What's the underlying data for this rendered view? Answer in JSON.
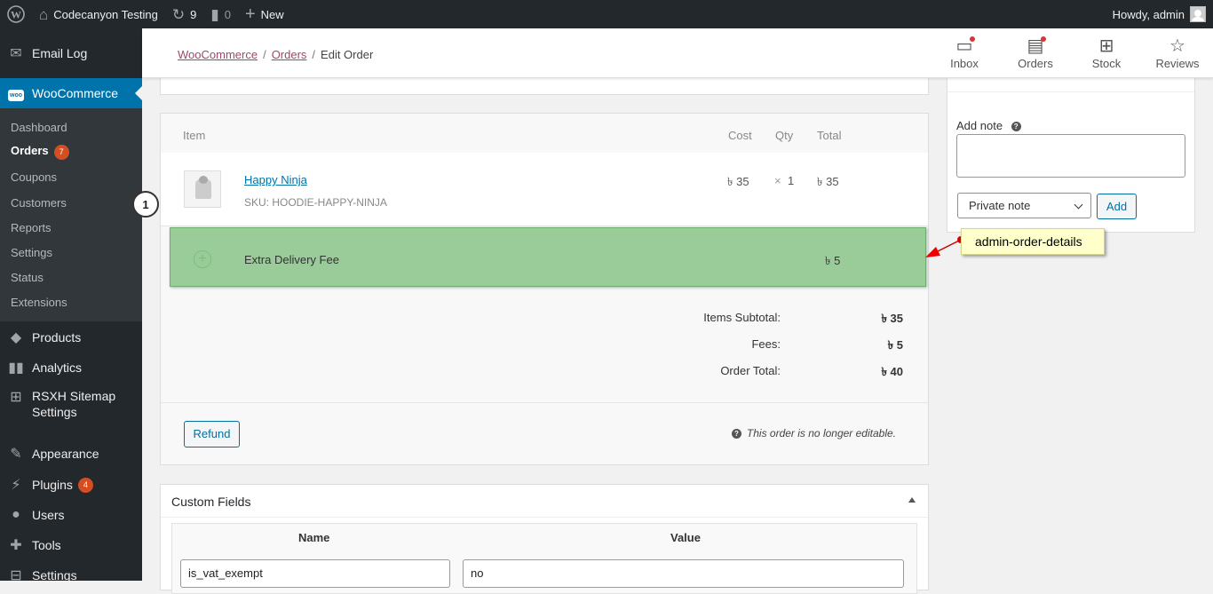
{
  "adminbar": {
    "site_name": "Codecanyon Testing",
    "updates_count": "9",
    "comments_count": "0",
    "new_label": "New",
    "howdy": "Howdy, admin"
  },
  "sidebar": {
    "email_log": "Email Log",
    "woocommerce": "WooCommerce",
    "submenu": {
      "dashboard": "Dashboard",
      "orders": "Orders",
      "orders_count": "7",
      "coupons": "Coupons",
      "customers": "Customers",
      "reports": "Reports",
      "settings": "Settings",
      "status": "Status",
      "extensions": "Extensions"
    },
    "products": "Products",
    "analytics": "Analytics",
    "rsxh_line1": "RSXH Sitemap",
    "rsxh_line2": "Settings",
    "appearance": "Appearance",
    "plugins": "Plugins",
    "plugins_count": "4",
    "users": "Users",
    "tools": "Tools",
    "settings": "Settings",
    "step_marker": "1"
  },
  "header": {
    "breadcrumb": [
      "WooCommerce",
      "Orders",
      "Edit Order"
    ],
    "actions": {
      "inbox": "Inbox",
      "orders": "Orders",
      "stock": "Stock",
      "reviews": "Reviews"
    }
  },
  "items": {
    "columns": {
      "item": "Item",
      "cost": "Cost",
      "qty": "Qty",
      "total": "Total"
    },
    "line": {
      "name": "Happy Ninja",
      "sku": "SKU: HOODIE-HAPPY-NINJA",
      "cost": "৳ 35",
      "qty_x": "×",
      "qty": "1",
      "total": "৳ 35"
    },
    "fee": {
      "name": "Extra Delivery Fee",
      "total": "৳ 5"
    },
    "totals": {
      "subtotal_label": "Items Subtotal:",
      "subtotal_value": "৳ 35",
      "fees_label": "Fees:",
      "fees_value": "৳ 5",
      "order_total_label": "Order Total:",
      "order_total_value": "৳ 40"
    },
    "refund_button": "Refund",
    "not_editable": "This order is no longer editable."
  },
  "custom_fields": {
    "title": "Custom Fields",
    "name_header": "Name",
    "value_header": "Value",
    "row": {
      "name": "is_vat_exempt",
      "value": "no"
    }
  },
  "notes": {
    "add_note_label": "Add note",
    "note_type": "Private note",
    "add_button": "Add"
  },
  "annotation": {
    "label": "admin-order-details"
  },
  "colors": {
    "adminbar_bg": "#23282d",
    "menu_active": "#0073aa",
    "highlight_fill": "#99cc99",
    "callout_bg": "#ffffcc",
    "badge": "#d54e21"
  }
}
